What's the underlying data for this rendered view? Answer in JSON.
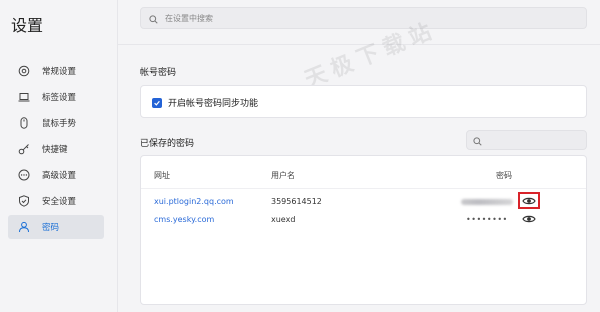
{
  "app": {
    "title": "设置"
  },
  "search": {
    "placeholder": "在设置中搜索"
  },
  "watermark": "天极下载站",
  "sidebar": {
    "items": [
      {
        "label": "常规设置",
        "icon": "settings-icon",
        "active": false
      },
      {
        "label": "标签设置",
        "icon": "laptop-icon",
        "active": false
      },
      {
        "label": "鼠标手势",
        "icon": "mouse-icon",
        "active": false
      },
      {
        "label": "快捷键",
        "icon": "key-icon",
        "active": false
      },
      {
        "label": "高级设置",
        "icon": "more-icon",
        "active": false
      },
      {
        "label": "安全设置",
        "icon": "shield-icon",
        "active": false
      },
      {
        "label": "密码",
        "icon": "user-icon",
        "active": true
      }
    ]
  },
  "account": {
    "section_title": "帐号密码",
    "sync_label": "开启帐号密码同步功能",
    "sync_checked": true
  },
  "saved": {
    "section_title": "已保存的密码",
    "columns": {
      "site": "网址",
      "username": "用户名",
      "password": "密码"
    },
    "rows": [
      {
        "site": "xui.ptlogin2.qq.com",
        "username": "3595614512",
        "password_mask": ""
      },
      {
        "site": "cms.yesky.com",
        "username": "xuexd",
        "password_mask": "••••••••"
      }
    ]
  },
  "colors": {
    "accent": "#2463d6",
    "link": "#2a6ad8",
    "highlight": "#d8232a"
  }
}
